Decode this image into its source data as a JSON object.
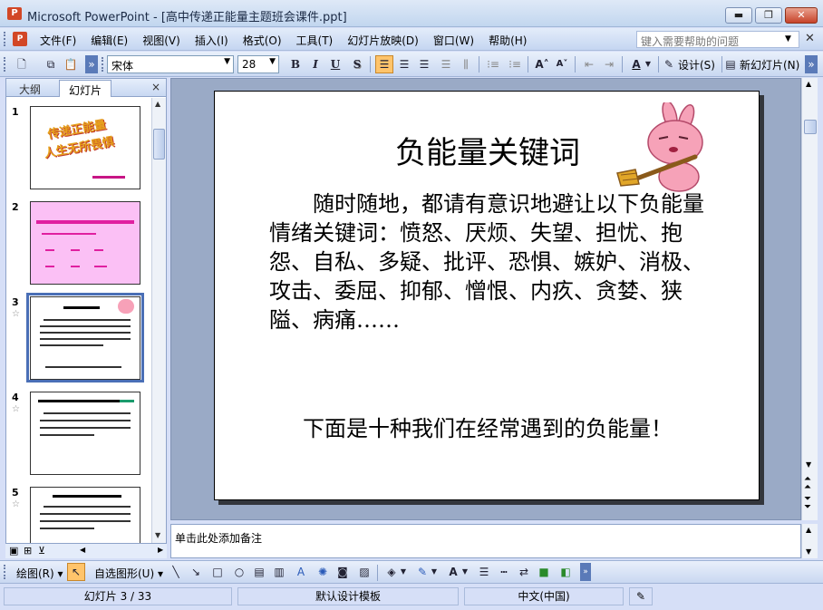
{
  "window": {
    "app_icon": "P",
    "title": "Microsoft PowerPoint - [高中传递正能量主题班会课件.ppt]",
    "minimize": "▬",
    "restore": "❐",
    "close": "✕"
  },
  "menu": {
    "items": [
      "文件(F)",
      "编辑(E)",
      "视图(V)",
      "插入(I)",
      "格式(O)",
      "工具(T)",
      "幻灯片放映(D)",
      "窗口(W)",
      "帮助(H)"
    ],
    "help_placeholder": "键入需要帮助的问题",
    "doc_close": "✕"
  },
  "toolbar": {
    "font": "宋体",
    "size": "28",
    "bold": "B",
    "italic": "I",
    "underline": "U",
    "shadow": "S",
    "design_label": "设计(S)",
    "new_slide_label": "新幻灯片(N)"
  },
  "left_panel": {
    "tab_outline": "大纲",
    "tab_slides": "幻灯片",
    "close": "×",
    "slides": [
      {
        "num": "1",
        "title": "传递正能量 人生无所畏惧"
      },
      {
        "num": "2",
        "title": ""
      },
      {
        "num": "3",
        "title": "负能量关键词"
      },
      {
        "num": "4",
        "title": "1、来自内心天使却消极"
      },
      {
        "num": "5",
        "title": "2、抱怨他人—抱怨"
      }
    ]
  },
  "slide": {
    "title": "负能量关键词",
    "body": "随时随地，都请有意识地避让以下负能量情绪关键词：愤怒、厌烦、失望、担忧、抱怨、自私、多疑、批评、恐惧、嫉妒、消极、攻击、委屈、抑郁、憎恨、内疚、贪婪、狭隘、病痛……",
    "bottom": "下面是十种我们在经常遇到的负能量！"
  },
  "notes": {
    "placeholder": "单击此处添加备注"
  },
  "drawbar": {
    "draw_label": "绘图(R)",
    "autoshape_label": "自选图形(U)"
  },
  "status": {
    "slide_pos": "幻灯片 3 / 33",
    "template": "默认设计模板",
    "language": "中文(中国)"
  }
}
